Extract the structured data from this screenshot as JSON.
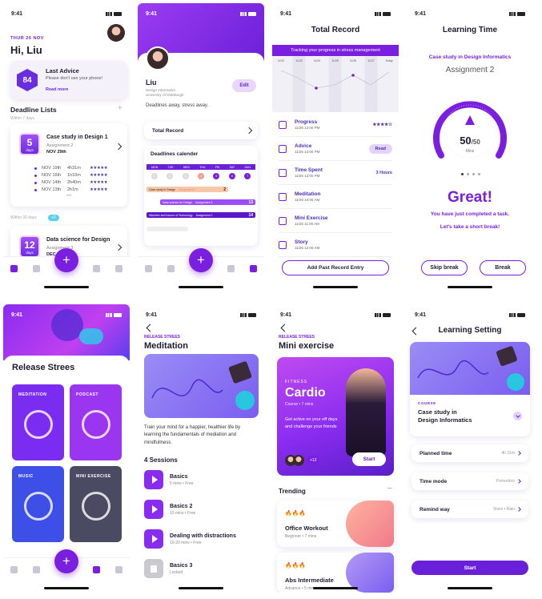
{
  "status_time": "9:41",
  "home": {
    "date": "THUR 26 NOV",
    "greeting": "Hi, Liu",
    "advice": {
      "score": "84",
      "title": "Last Advice",
      "text": "Please don't use your phone!",
      "link": "Read more"
    },
    "deadline_title": "Deadline Lists",
    "plus": "+",
    "within7": "Within 7 days",
    "card1": {
      "days": "5",
      "days_label": "days",
      "title": "Case study in Design 1",
      "sub": "Assignment 2",
      "date": "NOV 29th",
      "rows": [
        {
          "d": "NOV 19th",
          "t": "4h31m",
          "s": "★★★★★"
        },
        {
          "d": "NOV 16th",
          "t": "1h10m",
          "s": "★★★★★"
        },
        {
          "d": "NOV 14th",
          "t": "2h40m",
          "s": "★★★★★"
        },
        {
          "d": "NOV 13th",
          "t": "2h1m",
          "s": "★★★★★"
        }
      ],
      "more": "•••"
    },
    "within30": "Within 30 days",
    "within30_count": "+2",
    "card2": {
      "days": "12",
      "days_label": "days",
      "title": "Data science for Design",
      "sub": "Assignment 3",
      "date": "DEC 8th"
    }
  },
  "profile": {
    "name": "Liu",
    "school1": "Design Informatics",
    "school2": "University Of Edinburgh",
    "edit": "Edit",
    "tagline": "Deadlines away, stress away.",
    "total_record": "Total Record",
    "cal_title": "Deadlines calender",
    "days": [
      "MON",
      "TUE",
      "WED",
      "THU",
      "FRI",
      "SAT",
      "SUN"
    ],
    "dates": [
      "1",
      "2",
      "3",
      "4",
      "5",
      "6",
      "7"
    ],
    "bars": [
      {
        "label": "Case study in Design",
        "tag": "Assignment 2",
        "num": "2"
      },
      {
        "label": "Data science for Design",
        "tag": "Assignment 3",
        "num": "13"
      },
      {
        "label": "Histories and futures of Technology",
        "tag": "Assignment 1",
        "num": "14"
      }
    ]
  },
  "total": {
    "title": "Total Record",
    "banner": "Tracking your progress in stress management",
    "cols": [
      "11/22",
      "11/23",
      "11/24",
      "11/25",
      "11/26",
      "11/27",
      "Today"
    ],
    "rows": [
      {
        "name": "Progress",
        "date": "11/26 13:00 PM",
        "right": "★★★★☆",
        "icon": "star-icon"
      },
      {
        "name": "Advice",
        "date": "11/26 13:00 PM",
        "right": "Read",
        "icon": "pen-icon"
      },
      {
        "name": "Time Spent",
        "date": "11/26 13:00 PM",
        "right": "3 Hours",
        "icon": "clock-icon"
      },
      {
        "name": "Meditation",
        "date": "11/26 10:00 AM",
        "right": "",
        "icon": "head-icon"
      },
      {
        "name": "Mini Exercise",
        "date": "11/26 11:00 AM",
        "right": "",
        "icon": "run-icon"
      },
      {
        "name": "Story",
        "date": "11/26 12:00 AM",
        "right": "",
        "icon": "book-icon"
      }
    ],
    "add": "Add Past Record Entry"
  },
  "learning": {
    "title": "Learning Time",
    "course": "Case study in Design Informatics",
    "assignment": "Assignment 2",
    "count": "50",
    "total": "/50",
    "unit": "Mins",
    "great": "Great!",
    "msg1": "You have just completed a task.",
    "msg2": "Let's take a short break!",
    "skip": "Skip break",
    "break": "Break"
  },
  "release": {
    "title": "Release Strees",
    "tiles": [
      {
        "label": "MEDITATION",
        "color": "#7a2cf0"
      },
      {
        "label": "PODCAST",
        "color": "#9a35f0"
      },
      {
        "label": "MUSIC",
        "color": "#3e4fe8"
      },
      {
        "label": "MINI EXERCISE",
        "color": "#4b4a63"
      }
    ]
  },
  "meditation": {
    "kicker": "RELEASE STREES",
    "title": "Meditation",
    "desc": "Train your mind for a happier, healthier life by learning the fundamentals of mediation and mindfullness.",
    "sessions_title": "4 Sessions",
    "sessions": [
      {
        "t": "Basics",
        "d": "5 mins • Free"
      },
      {
        "t": "Basics 2",
        "d": "10 mins • Free"
      },
      {
        "t": "Dealing with distractions",
        "d": "10-20 mins • Free"
      },
      {
        "t": "Basics 3",
        "d": "Locked"
      }
    ]
  },
  "mini": {
    "kicker": "RELEASE STREES",
    "title": "Mini exercise",
    "tag": "FITNESS",
    "name": "Cardio",
    "course": "Course • 7 mins",
    "desc": "Get active on your off days and challenge your friends",
    "count": "+12",
    "start": "Start",
    "trending": "Trending",
    "dots": "•••",
    "items": [
      {
        "t": "Office Workout",
        "d": "Beginner • 7 mins"
      },
      {
        "t": "Abs Intermediate",
        "d": "Advance • 5 mins"
      }
    ]
  },
  "setting": {
    "title": "Learning Setting",
    "course_label": "COURSE",
    "course1": "Case study in",
    "course2": "Design Informatics",
    "rows": [
      {
        "l": "Planned time",
        "v": "4h 31m"
      },
      {
        "l": "Time mode",
        "v": "Pomodoro"
      },
      {
        "l": "Remind way",
        "v": "Voice • Rain"
      }
    ],
    "start": "Start"
  }
}
